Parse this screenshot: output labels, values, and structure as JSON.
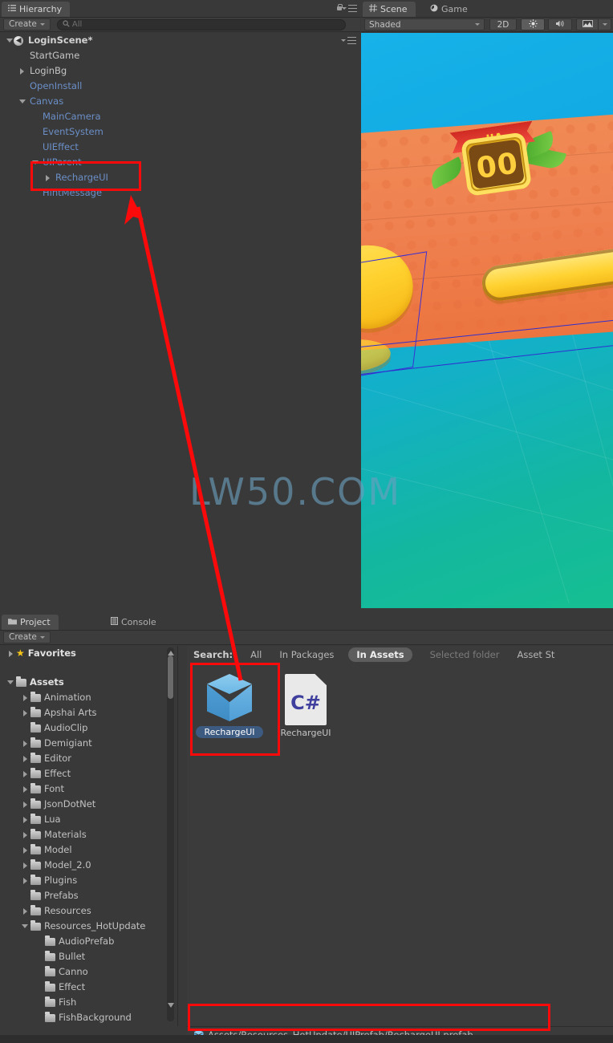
{
  "hierarchy": {
    "tab_label": "Hierarchy",
    "tab_icon": "hierarchy-icon",
    "lock_icon": "lock-icon",
    "menu_icon": "panel-menu-icon",
    "create_label": "Create",
    "search_placeholder": "All",
    "search_value": "",
    "scene_name": "LoginScene*",
    "items": [
      {
        "label": "StartGame",
        "indent": 1,
        "twisty": "none",
        "color": "white"
      },
      {
        "label": "LoginBg",
        "indent": 1,
        "twisty": "collapsed",
        "color": "white"
      },
      {
        "label": "OpenInstall",
        "indent": 1,
        "twisty": "none",
        "color": "blue"
      },
      {
        "label": "Canvas",
        "indent": 1,
        "twisty": "expanded",
        "color": "blue"
      },
      {
        "label": "MainCamera",
        "indent": 2,
        "twisty": "none",
        "color": "blue"
      },
      {
        "label": "EventSystem",
        "indent": 2,
        "twisty": "none",
        "color": "blue"
      },
      {
        "label": "UIEffect",
        "indent": 2,
        "twisty": "none",
        "color": "blue"
      },
      {
        "label": "UIParent",
        "indent": 2,
        "twisty": "expanded",
        "color": "blue"
      },
      {
        "label": "RechargeUI",
        "indent": 3,
        "twisty": "collapsed",
        "color": "blue"
      },
      {
        "label": "HintMessage",
        "indent": 2,
        "twisty": "none",
        "color": "blue"
      }
    ]
  },
  "scene_panel": {
    "tabs": [
      {
        "label": "Scene",
        "icon": "grid-icon",
        "active": true
      },
      {
        "label": "Game",
        "icon": "gamepad-icon",
        "active": false
      }
    ],
    "draw_mode": "Shaded",
    "mode_2d": "2D",
    "lighting_icon": "sun-icon",
    "audio_icon": "speaker-icon",
    "fx_icon": "image-effects-icon",
    "fx_caret": "chevron-down-icon",
    "game_art": {
      "badge_digits": "00",
      "badge_ribbon": "VIP"
    }
  },
  "project_panel": {
    "tabs": [
      {
        "label": "Project",
        "icon": "folder-icon",
        "active": true
      },
      {
        "label": "Console",
        "icon": "console-icon",
        "active": false
      }
    ],
    "create_label": "Create",
    "favorites_label": "Favorites",
    "search": {
      "label": "Search:",
      "options": [
        {
          "label": "All",
          "state": "normal"
        },
        {
          "label": "In Packages",
          "state": "normal"
        },
        {
          "label": "In Assets",
          "state": "selected"
        },
        {
          "label": "Selected folder",
          "state": "dim"
        },
        {
          "label": "Asset St",
          "state": "normal"
        }
      ]
    },
    "tree": [
      {
        "label": "Assets",
        "indent": 0,
        "twisty": "expanded",
        "bold": true
      },
      {
        "label": "Animation",
        "indent": 1,
        "twisty": "collapsed",
        "bold": false
      },
      {
        "label": "Apshai Arts",
        "indent": 1,
        "twisty": "collapsed",
        "bold": false
      },
      {
        "label": "AudioClip",
        "indent": 1,
        "twisty": "none",
        "bold": false
      },
      {
        "label": "Demigiant",
        "indent": 1,
        "twisty": "collapsed",
        "bold": false
      },
      {
        "label": "Editor",
        "indent": 1,
        "twisty": "collapsed",
        "bold": false
      },
      {
        "label": "Effect",
        "indent": 1,
        "twisty": "collapsed",
        "bold": false
      },
      {
        "label": "Font",
        "indent": 1,
        "twisty": "collapsed",
        "bold": false
      },
      {
        "label": "JsonDotNet",
        "indent": 1,
        "twisty": "collapsed",
        "bold": false
      },
      {
        "label": "Lua",
        "indent": 1,
        "twisty": "collapsed",
        "bold": false
      },
      {
        "label": "Materials",
        "indent": 1,
        "twisty": "collapsed",
        "bold": false
      },
      {
        "label": "Model",
        "indent": 1,
        "twisty": "collapsed",
        "bold": false
      },
      {
        "label": "Model_2.0",
        "indent": 1,
        "twisty": "collapsed",
        "bold": false
      },
      {
        "label": "Plugins",
        "indent": 1,
        "twisty": "collapsed",
        "bold": false
      },
      {
        "label": "Prefabs",
        "indent": 1,
        "twisty": "none",
        "bold": false
      },
      {
        "label": "Resources",
        "indent": 1,
        "twisty": "collapsed",
        "bold": false
      },
      {
        "label": "Resources_HotUpdate",
        "indent": 1,
        "twisty": "expanded",
        "bold": false
      },
      {
        "label": "AudioPrefab",
        "indent": 2,
        "twisty": "none",
        "bold": false
      },
      {
        "label": "Bullet",
        "indent": 2,
        "twisty": "none",
        "bold": false
      },
      {
        "label": "Canno",
        "indent": 2,
        "twisty": "none",
        "bold": false
      },
      {
        "label": "Effect",
        "indent": 2,
        "twisty": "none",
        "bold": false
      },
      {
        "label": "Fish",
        "indent": 2,
        "twisty": "none",
        "bold": false
      },
      {
        "label": "FishBackground",
        "indent": 2,
        "twisty": "none",
        "bold": false
      }
    ],
    "assets": [
      {
        "label": "RechargeUI",
        "icon": "prefab-cube-icon",
        "selected": true
      },
      {
        "label": "RechargeUI",
        "icon": "csharp-script-icon",
        "selected": false
      }
    ],
    "status_path": "Assets/Resources_HotUpdate/UIPrefab/RechargeUI.prefab",
    "status_icon": "prefab-cube-icon"
  },
  "watermark": {
    "text": "LW50.COM"
  },
  "annotations": {
    "accent_color": "#fa0a0a",
    "boxes": [
      {
        "name": "hierarchy-recharge-highlight"
      },
      {
        "name": "asset-grid-recharge-highlight"
      },
      {
        "name": "status-path-highlight"
      }
    ],
    "arrow": {
      "name": "drag-direction-arrow",
      "from": "asset-grid",
      "to": "hierarchy-recharge"
    }
  }
}
